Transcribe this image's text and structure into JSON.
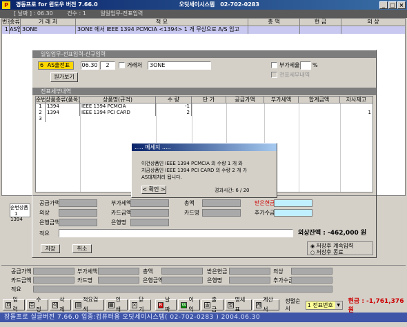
{
  "window": {
    "title": "경동프로 for 윈도우 버전 7.66.0",
    "company": "오딧세이시스템",
    "phone": "02-702-0283",
    "icon_text": "P",
    "min": "_",
    "max": "□",
    "close": "×"
  },
  "toolbar": {
    "date_label": "[ 날짜 ] : 06.30",
    "count_label": "건수 : 1",
    "screen_label": "일일업무-전표입력"
  },
  "main_grid": {
    "headers": [
      "번호",
      "종류",
      "거 래 처",
      "적 요",
      "총 액",
      "현 금",
      "외 상"
    ],
    "rows": [
      {
        "no": "1",
        "type": "AS입",
        "client": "3ONE",
        "memo": "3ONE 에서 IEEE 1394 PCMCIA <1394> 1 개 무상으로 A/S 입고",
        "total": "",
        "cash": "",
        "credit": ""
      }
    ]
  },
  "dialog": {
    "title": "일일업무-전표입력-신규입력",
    "badge_num": "6",
    "badge_text": "AS출전표",
    "date": "06.30",
    "seq": "2",
    "client_label": "거래처",
    "client_value": "3ONE",
    "vat_label": "부가세율",
    "vat_unit": "%",
    "vat_print_label": "전표세부내역",
    "original_btn": "원가보기",
    "details_title": "전표세부내역",
    "details_headers": [
      "순번",
      "상품종류(품목)",
      "상품명(규격)",
      "수 량",
      "단 가",
      "공급가액",
      "부가세액",
      "합계금액",
      "자사재고"
    ],
    "details_rows": [
      {
        "no": "1",
        "kind": "1394",
        "name": "IEEE 1394 PCMCIA",
        "qty": "-1",
        "stock": ""
      },
      {
        "no": "2",
        "kind": "1394",
        "name": "IEEE 1394 PCI CARD",
        "qty": "2",
        "stock": "1"
      },
      {
        "no": "3",
        "kind": "",
        "name": "",
        "qty": "",
        "stock": ""
      }
    ]
  },
  "message": {
    "title": "..... 메세지 .....",
    "line1": "이건상품인   IEEE 1394 PCMCIA          의 수량 1 개 와",
    "line2": "지금상품인   IEEE 1394 PCI CARD        의 수량 2 개 가",
    "line3": "AS대체처리 됩니다.",
    "ok": "< 확인 >",
    "elapsed": "경과시간: 6 / 20"
  },
  "lower_form": {
    "row_header": [
      "순번",
      "상품"
    ],
    "row_values": [
      "1",
      "1394"
    ],
    "labels": {
      "supply": "공급가액",
      "vat": "부가세액",
      "total": "총액",
      "received": "받은현금",
      "credit": "외상",
      "card_amt": "카드금액",
      "card_name": "카드명",
      "add_amt": "추가수금",
      "bank_amt": "은행금액",
      "bank_name": "은행명",
      "memo": "적요"
    },
    "balance": "외상잔액 : -462,000 원",
    "save_btn": "저장",
    "cancel_btn": "취소",
    "radio1": "저장후 계속입력",
    "radio2": "저장후 종료"
  },
  "bottom_form": {
    "labels": {
      "supply": "공급가액",
      "vat": "부가세액",
      "total": "총액",
      "received": "받은현금",
      "credit": "외상",
      "card_amt": "카드금액",
      "card_name": "카드명",
      "bank_amt": "은행금액",
      "bank_name": "은행명",
      "add_amt": "추가수금",
      "memo": "적요"
    }
  },
  "bottom_bar": {
    "buttons": [
      {
        "icon": "D",
        "label": "입력"
      },
      {
        "icon": "수",
        "label": "수정"
      },
      {
        "icon": "삭",
        "label": "삭제"
      },
      {
        "icon": "▤",
        "label": "적요검색"
      },
      {
        "icon": "▦",
        "label": "인쇄"
      },
      {
        "icon": "×",
        "label": "닫기"
      },
      {
        "icon": "B",
        "label": "날짜"
      },
      {
        "icon": "W",
        "label": "이익"
      },
      {
        "icon": "출",
        "label": "출금"
      },
      {
        "icon": "명",
        "label": "명세표"
      },
      {
        "icon": "계",
        "label": "계산서"
      }
    ],
    "sort_label": "정렬순서",
    "sort_value": "1 전표번호",
    "cash_total": "현금 : -1,761,376 원"
  },
  "status_bar": {
    "text": "장돌프로 실글버전  7.66.0    업종:컴퓨터용   오딧세이시스템( 02-702-0283 )     2004.06.30"
  },
  "colors": {
    "title_bg": "#0a246a",
    "selected_row": "#c8c8f0",
    "badge": "#ffd700",
    "highlight_red": "#cc0000",
    "status_bg": "#3f55a8"
  }
}
